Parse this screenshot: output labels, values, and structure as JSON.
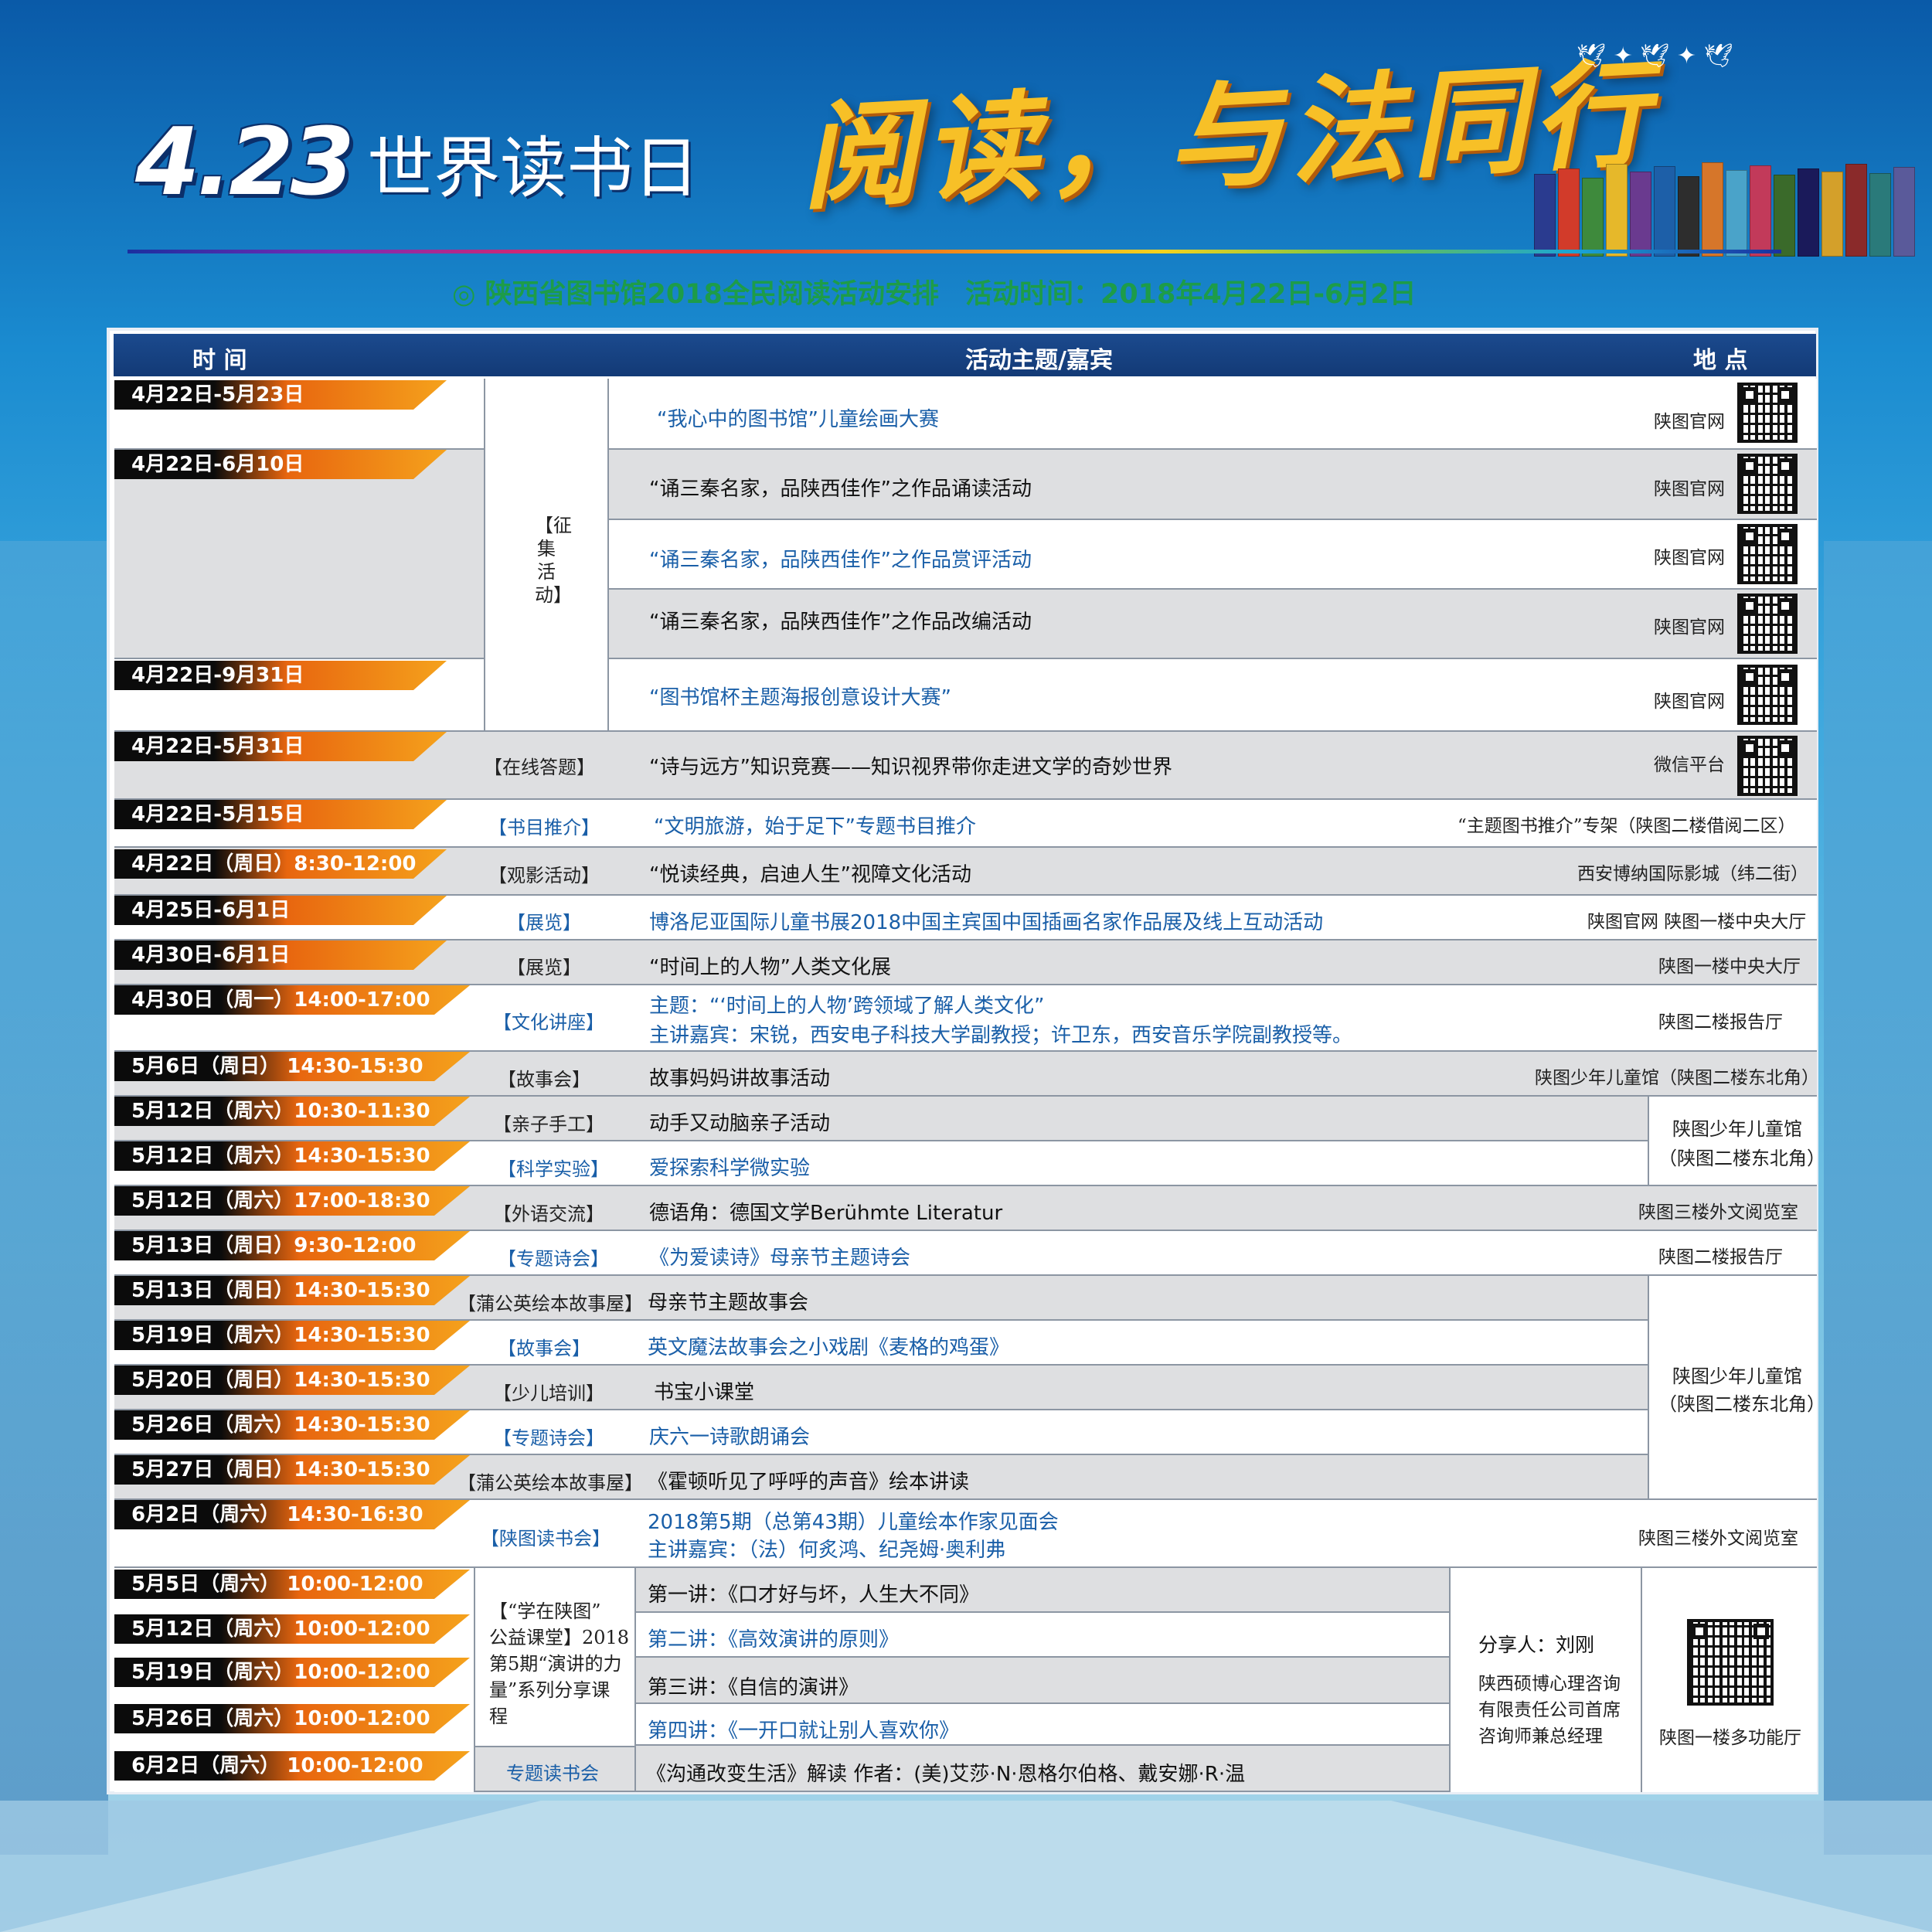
{
  "header": {
    "date_num": "4.23",
    "day_name": "世界读书日",
    "slogan": "阅读，与法同行",
    "subtitle": "陕西省图书馆2018全民阅读活动安排",
    "subtitle_time": "活动时间：2018年4月22日-6月2日"
  },
  "table_header": {
    "time": "时 间",
    "activity": "活动主题/嘉宾",
    "place": "地 点"
  },
  "collect_category": "【征集活动】",
  "collect_rows": [
    {
      "date": "4月22日-5月23日",
      "title": "“我心中的图书馆”儿童绘画大赛",
      "place": "陕图官网"
    },
    {
      "date": "4月22日-6月10日",
      "title": "“诵三秦名家，品陕西佳作”之作品诵读活动",
      "place": "陕图官网"
    },
    {
      "date": "",
      "title": "“诵三秦名家，品陕西佳作”之作品赏评活动",
      "place": "陕图官网"
    },
    {
      "date": "",
      "title": "“诵三秦名家，品陕西佳作”之作品改编活动",
      "place": "陕图官网"
    },
    {
      "date": "4月22日-9月31日",
      "title": "“图书馆杯主题海报创意设计大赛”",
      "place": "陕图官网"
    }
  ],
  "rows": [
    {
      "date": "4月22日-5月31日",
      "cat": "【在线答题】",
      "title": "“诗与远方”知识竞赛——知识视界带你走进文学的奇妙世界",
      "place": "微信平台"
    },
    {
      "date": "4月22日-5月15日",
      "cat": "【书目推介】",
      "title": "“文明旅游，始于足下”专题书目推介",
      "place": "“主题图书推介”专架（陕图二楼借阅二区）"
    },
    {
      "date": "4月22日（周日）8:30-12:00",
      "cat": "【观影活动】",
      "title": "“悦读经典，启迪人生”视障文化活动",
      "place": "西安博纳国际影城（纬二街）"
    },
    {
      "date": "4月25日-6月1日",
      "cat": "【展览】",
      "title": "博洛尼亚国际儿童书展2018中国主宾国中国插画名家作品展及线上互动活动",
      "place": "陕图官网  陕图一楼中央大厅"
    },
    {
      "date": "4月30日-6月1日",
      "cat": "【展览】",
      "title": "“时间上的人物”人类文化展",
      "place": "陕图一楼中央大厅"
    },
    {
      "date": "4月30日（周一）14:00-17:00",
      "cat": "【文化讲座】",
      "title": "主题：“‘时间上的人物’跨领域了解人类文化”",
      "title2": "主讲嘉宾：宋锐，西安电子科技大学副教授；许卫东，西安音乐学院副教授等。",
      "place": "陕图二楼报告厅"
    },
    {
      "date": "5月6日（周日） 14:30-15:30",
      "cat": "【故事会】",
      "title": "故事妈妈讲故事活动",
      "place": "陕图少年儿童馆（陕图二楼东北角）"
    },
    {
      "date": "5月12日（周六）10:30-11:30",
      "cat": "【亲子手工】",
      "title": "动手又动脑亲子活动"
    },
    {
      "date": "5月12日（周六）14:30-15:30",
      "cat": "【科学实验】",
      "title": "爱探索科学微实验"
    },
    {
      "date": "5月12日（周六）17:00-18:30",
      "cat": "【外语交流】",
      "title": "德语角：德国文学Berühmte Literatur",
      "place": "陕图三楼外文阅览室"
    },
    {
      "date": "5月13日（周日）9:30-12:00",
      "cat": "【专题诗会】",
      "title": "《为爱读诗》母亲节主题诗会",
      "place": "陕图二楼报告厅"
    },
    {
      "date": "5月13日（周日）14:30-15:30",
      "cat": "【蒲公英绘本故事屋】",
      "title": "母亲节主题故事会"
    },
    {
      "date": "5月19日（周六）14:30-15:30",
      "cat": "【故事会】",
      "title": "英文魔法故事会之小戏剧《麦格的鸡蛋》"
    },
    {
      "date": "5月20日（周日）14:30-15:30",
      "cat": "【少儿培训】",
      "title": "书宝小课堂"
    },
    {
      "date": "5月26日（周六）14:30-15:30",
      "cat": "【专题诗会】",
      "title": "庆六一诗歌朗诵会"
    },
    {
      "date": "5月27日（周日）14:30-15:30",
      "cat": "【蒲公英绘本故事屋】",
      "title": "《霍顿听见了呼呼的声音》绘本讲读"
    },
    {
      "date": "6月2日（周六） 14:30-16:30",
      "cat": "【陕图读书会】",
      "title": "2018第5期（总第43期）儿童绘本作家见面会",
      "title2": "主讲嘉宾：（法）何炙鸿、纪尧姆·奥利弗",
      "place": "陕图三楼外文阅览室"
    }
  ],
  "merged_places": {
    "kids_a_1": "陕图少年儿童馆",
    "kids_a_2": "（陕图二楼东北角）",
    "kids_b_1": "陕图少年儿童馆",
    "kids_b_2": "（陕图二楼东北角）"
  },
  "lecture": {
    "cat_lines": [
      "【“学在陕图”",
      "公益课堂】2018",
      "第5期“演讲的力",
      "量”系列分享课",
      "程"
    ],
    "rows": [
      {
        "date": "5月5日（周六） 10:00-12:00",
        "title": "第一讲：《口才好与坏，人生大不同》"
      },
      {
        "date": "5月12日（周六）10:00-12:00",
        "title": "第二讲：《高效演讲的原则》"
      },
      {
        "date": "5月19日（周六）10:00-12:00",
        "title": "第三讲：《自信的演讲》"
      },
      {
        "date": "5月26日（周六）10:00-12:00",
        "title": "第四讲：《一开口就让别人喜欢你》"
      }
    ],
    "last_date": "6月2日（周六） 10:00-12:00",
    "last_cat": "专题读书会",
    "last_title": "《沟通改变生活》解读    作者：(美)艾莎·N·恩格尔伯格、戴安娜·R·温",
    "sharer_label": "分享人：刘刚",
    "sharer_desc": [
      "陕西硕博心理咨询",
      "有限责任公司首席",
      "咨询师兼总经理"
    ],
    "place": "陕图一楼多功能厅"
  },
  "colors": {
    "accent_orange": "#f08a1b",
    "header_blue": "#1b4a8e",
    "text_blue": "#1a5fa8",
    "subtitle_green": "#1d9c49"
  }
}
